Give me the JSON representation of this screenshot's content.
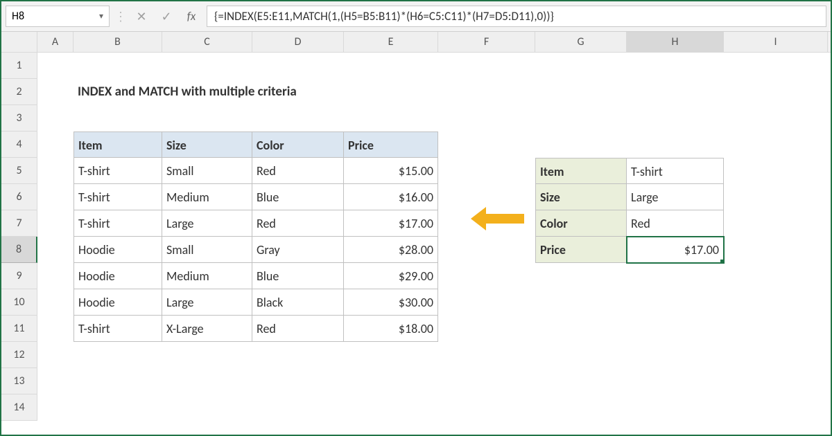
{
  "formula_bar": {
    "cell_ref": "H8",
    "formula": "{=INDEX(E5:E11,MATCH(1,(H5=B5:B11)*(H6=C5:C11)*(H7=D5:D11),0))}"
  },
  "columns": [
    "A",
    "B",
    "C",
    "D",
    "E",
    "F",
    "G",
    "H",
    "I"
  ],
  "col_widths": [
    "wA",
    "wB",
    "wC",
    "wD",
    "wE",
    "wF",
    "wG",
    "wH",
    "wI"
  ],
  "selected_col": "H",
  "selected_row": 8,
  "title": "INDEX and MATCH with multiple criteria",
  "table": {
    "headers": [
      "Item",
      "Size",
      "Color",
      "Price"
    ],
    "rows": [
      [
        "T-shirt",
        "Small",
        "Red",
        "$15.00"
      ],
      [
        "T-shirt",
        "Medium",
        "Blue",
        "$16.00"
      ],
      [
        "T-shirt",
        "Large",
        "Red",
        "$17.00"
      ],
      [
        "Hoodie",
        "Small",
        "Gray",
        "$28.00"
      ],
      [
        "Hoodie",
        "Medium",
        "Blue",
        "$29.00"
      ],
      [
        "Hoodie",
        "Large",
        "Black",
        "$30.00"
      ],
      [
        "T-shirt",
        "X-Large",
        "Red",
        "$18.00"
      ]
    ]
  },
  "lookup": {
    "pairs": [
      [
        "Item",
        "T-shirt"
      ],
      [
        "Size",
        "Large"
      ],
      [
        "Color",
        "Red"
      ],
      [
        "Price",
        "$17.00"
      ]
    ]
  },
  "icons": {
    "dropdown": "▾",
    "sep": "⋮",
    "cancel": "✕",
    "confirm": "✓",
    "fx": "fx"
  },
  "chart_data": {
    "type": "table",
    "title": "INDEX and MATCH with multiple criteria",
    "columns": [
      "Item",
      "Size",
      "Color",
      "Price"
    ],
    "rows": [
      {
        "Item": "T-shirt",
        "Size": "Small",
        "Color": "Red",
        "Price": 15.0
      },
      {
        "Item": "T-shirt",
        "Size": "Medium",
        "Color": "Blue",
        "Price": 16.0
      },
      {
        "Item": "T-shirt",
        "Size": "Large",
        "Color": "Red",
        "Price": 17.0
      },
      {
        "Item": "Hoodie",
        "Size": "Small",
        "Color": "Gray",
        "Price": 28.0
      },
      {
        "Item": "Hoodie",
        "Size": "Medium",
        "Color": "Blue",
        "Price": 29.0
      },
      {
        "Item": "Hoodie",
        "Size": "Large",
        "Color": "Black",
        "Price": 30.0
      },
      {
        "Item": "T-shirt",
        "Size": "X-Large",
        "Color": "Red",
        "Price": 18.0
      }
    ],
    "lookup_result": {
      "Item": "T-shirt",
      "Size": "Large",
      "Color": "Red",
      "Price": 17.0
    }
  }
}
